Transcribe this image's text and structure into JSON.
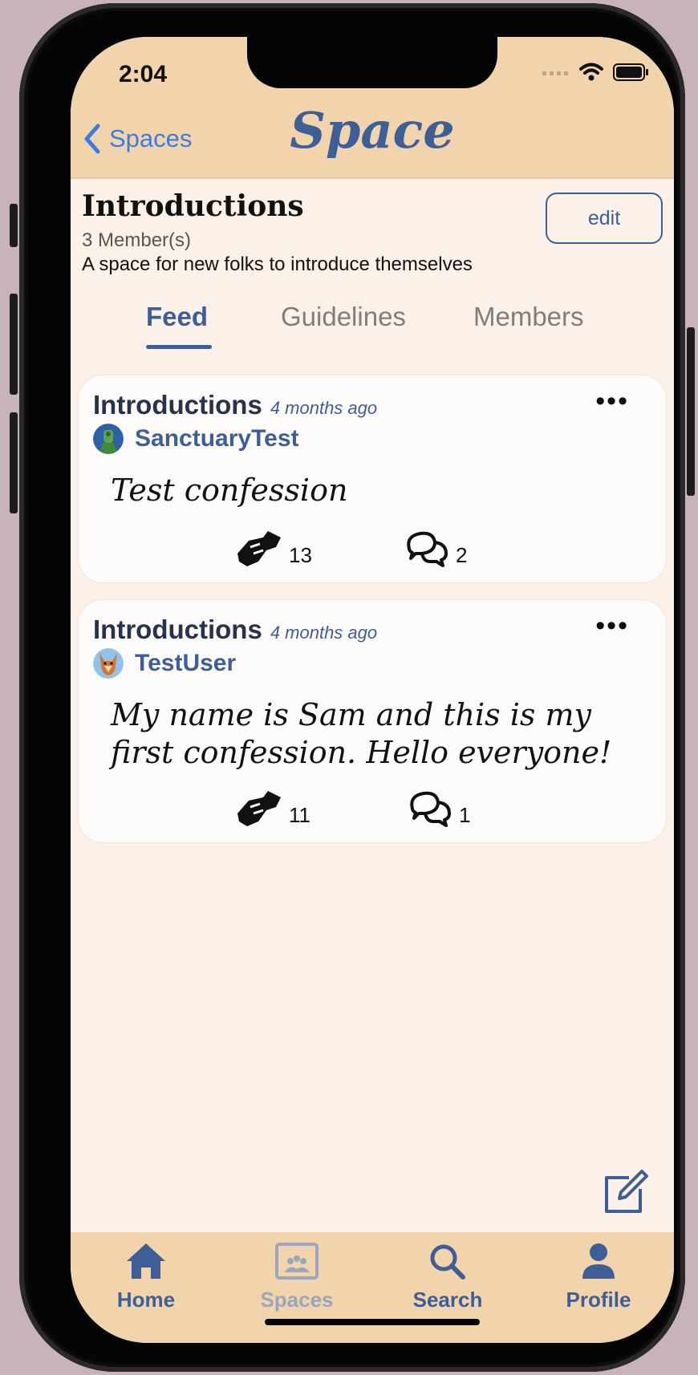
{
  "status_bar": {
    "time": "2:04"
  },
  "nav": {
    "back_label": "Spaces",
    "title": "Space"
  },
  "space": {
    "name": "Introductions",
    "members": "3 Member(s)",
    "description": "A space for new folks to introduce themselves",
    "edit_label": "edit"
  },
  "tabs": [
    {
      "label": "Feed",
      "active": true
    },
    {
      "label": "Guidelines",
      "active": false
    },
    {
      "label": "Members",
      "active": false
    }
  ],
  "posts": [
    {
      "space": "Introductions",
      "time": "4 months ago",
      "author": "SanctuaryTest",
      "body": "Test confession",
      "likes": "13",
      "comments": "2"
    },
    {
      "space": "Introductions",
      "time": "4 months ago",
      "author": "TestUser",
      "body_line1": "My name is Sam and this is my",
      "body_line2": "first confession. Hello everyone!",
      "likes": "11",
      "comments": "1"
    }
  ],
  "tabbar": [
    {
      "label": "Home",
      "icon": "home-icon"
    },
    {
      "label": "Spaces",
      "icon": "spaces-icon"
    },
    {
      "label": "Search",
      "icon": "search-icon"
    },
    {
      "label": "Profile",
      "icon": "profile-icon"
    }
  ],
  "colors": {
    "accent": "#3e5e98",
    "header_bg": "#f2d4ac",
    "page_bg": "#fbf1e8",
    "link_blue": "#3b7be6"
  }
}
